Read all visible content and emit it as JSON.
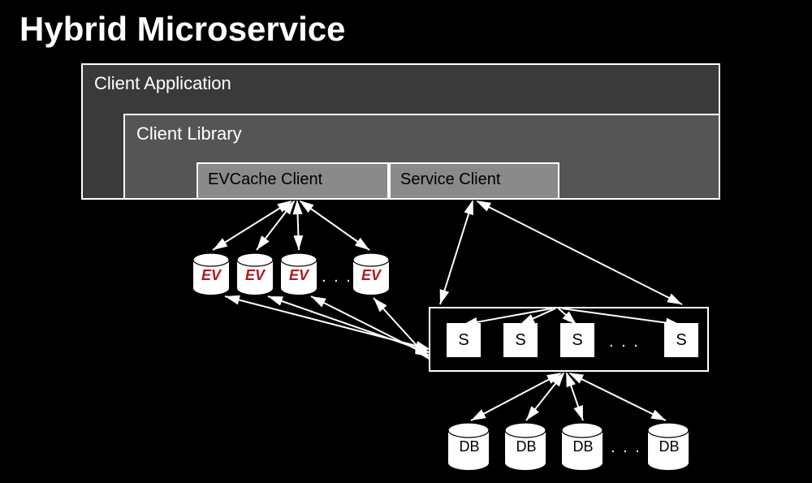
{
  "title": "Hybrid Microservice",
  "layers": {
    "client_app": "Client Application",
    "client_lib": "Client Library",
    "evcache_client": "EVCache Client",
    "service_client": "Service Client"
  },
  "nodes": {
    "ev_label": "EV",
    "s_label": "S",
    "db_label": "DB",
    "ellipsis": ". . ."
  },
  "colors": {
    "ev_accent": "#b01820"
  }
}
